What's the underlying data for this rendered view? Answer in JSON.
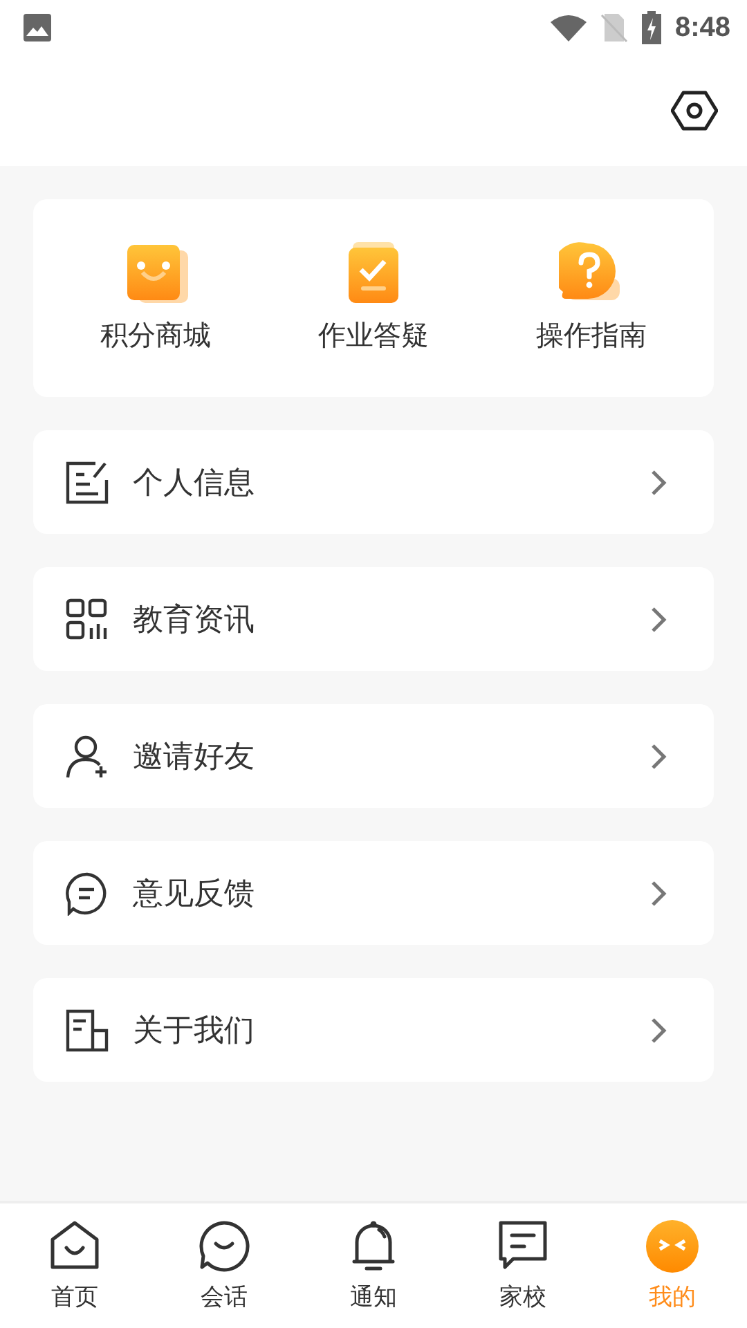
{
  "status_bar": {
    "time": "8:48"
  },
  "quick_actions": [
    {
      "label": "积分商城"
    },
    {
      "label": "作业答疑"
    },
    {
      "label": "操作指南"
    }
  ],
  "menu": [
    {
      "label": "个人信息"
    },
    {
      "label": "教育资讯"
    },
    {
      "label": "邀请好友"
    },
    {
      "label": "意见反馈"
    },
    {
      "label": "关于我们"
    }
  ],
  "tabs": [
    {
      "label": "首页",
      "selected": false
    },
    {
      "label": "会话",
      "selected": false
    },
    {
      "label": "通知",
      "selected": false
    },
    {
      "label": "家校",
      "selected": false
    },
    {
      "label": "我的",
      "selected": true
    }
  ]
}
